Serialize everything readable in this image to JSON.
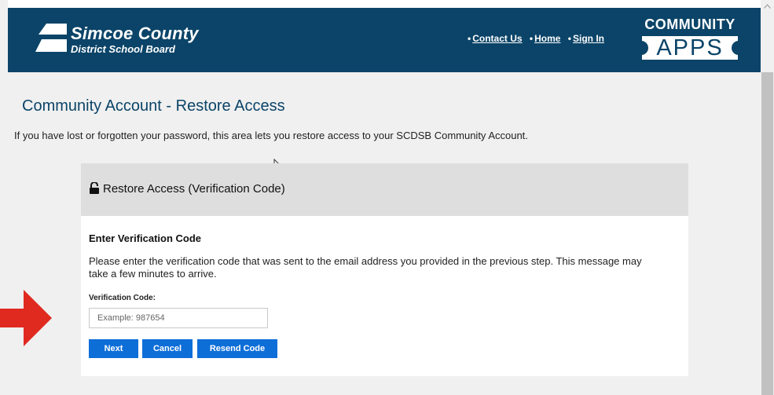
{
  "header": {
    "logo_title": "Simcoe County",
    "logo_subtitle": "District School Board",
    "nav": [
      {
        "label": "Contact Us"
      },
      {
        "label": "Home"
      },
      {
        "label": "Sign In"
      }
    ],
    "nav_bullet": "•",
    "apps_top": "COMMUNITY",
    "apps_bottom": "APPS"
  },
  "main": {
    "title": "Community Account - Restore Access",
    "intro": "If you have lost or forgotten your password, this area lets you restore access to your SCDSB Community Account."
  },
  "panel": {
    "header_title": "Restore Access (Verification Code)",
    "header_icon": "unlock-icon",
    "section_title": "Enter Verification Code",
    "description": "Please enter the verification code that was sent to the email address you provided in the previous step. This message may take a few minutes to arrive.",
    "field_label": "Verification Code:",
    "field_placeholder": "Example: 987654",
    "field_value": "",
    "buttons": {
      "next": "Next",
      "cancel": "Cancel",
      "resend": "Resend Code"
    }
  },
  "colors": {
    "header_bg": "#0b4468",
    "title": "#0b4468",
    "button": "#0e6ed8",
    "arrow": "#e02a20",
    "panel_header": "#dedede"
  }
}
